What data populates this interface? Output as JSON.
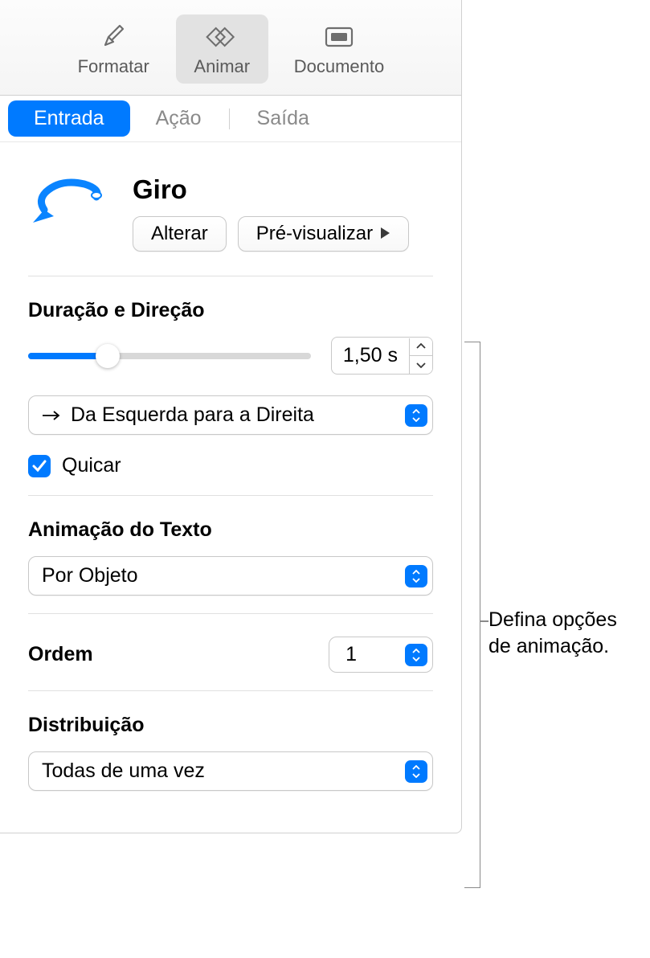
{
  "toolbar": {
    "format_label": "Formatar",
    "animate_label": "Animar",
    "document_label": "Documento"
  },
  "tabs": {
    "entry_label": "Entrada",
    "action_label": "Ação",
    "exit_label": "Saída"
  },
  "effect": {
    "title": "Giro",
    "change_label": "Alterar",
    "preview_label": "Pré-visualizar"
  },
  "duration": {
    "section_title": "Duração e Direção",
    "value": "1,50 s",
    "direction_label": "Da Esquerda para a Direita",
    "bounce_label": "Quicar"
  },
  "text_animation": {
    "section_title": "Animação do Texto",
    "value": "Por Objeto"
  },
  "order": {
    "label": "Ordem",
    "value": "1"
  },
  "distribution": {
    "section_title": "Distribuição",
    "value": "Todas de uma vez"
  },
  "callout": {
    "text1": "Defina opções",
    "text2": "de animação."
  }
}
